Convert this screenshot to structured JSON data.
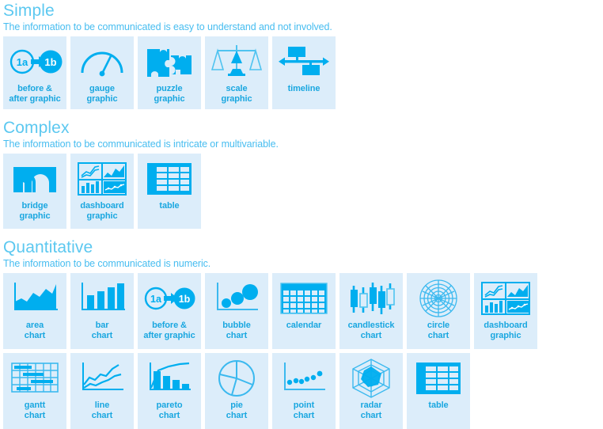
{
  "colors": {
    "tile_bg": "#dcedfa",
    "icon_blue": "#00aeef",
    "caption_blue": "#1aa7e0",
    "heading_blue": "#5cc8f0",
    "subtitle_blue": "#47bdf0",
    "page_bg": "#ffffff"
  },
  "sections": [
    {
      "id": "simple",
      "title": "Simple",
      "subtitle": "The information to be communicated is easy to understand and not involved.",
      "tiles": [
        {
          "icon": "before-after-graphic-icon",
          "label": "before &\nafter graphic",
          "line1": "before &",
          "line2": "after graphic"
        },
        {
          "icon": "gauge-graphic-icon",
          "label": "gauge graphic",
          "line1": "gauge",
          "line2": "graphic"
        },
        {
          "icon": "puzzle-graphic-icon",
          "label": "puzzle graphic",
          "line1": "puzzle",
          "line2": "graphic"
        },
        {
          "icon": "scale-graphic-icon",
          "label": "scale graphic",
          "line1": "scale",
          "line2": "graphic"
        },
        {
          "icon": "timeline-icon",
          "label": "timeline",
          "line1": "timeline",
          "line2": ""
        }
      ]
    },
    {
      "id": "complex",
      "title": "Complex",
      "subtitle": "The information to be communicated is intricate or multivariable.",
      "tiles": [
        {
          "icon": "bridge-graphic-icon",
          "label": "bridge graphic",
          "line1": "bridge",
          "line2": "graphic"
        },
        {
          "icon": "dashboard-graphic-icon",
          "label": "dashboard graphic",
          "line1": "dashboard",
          "line2": "graphic"
        },
        {
          "icon": "table-icon",
          "label": "table",
          "line1": "table",
          "line2": ""
        }
      ]
    },
    {
      "id": "quantitative",
      "title": "Quantitative",
      "subtitle": "The information to be communicated is numeric.",
      "tiles": [
        {
          "icon": "area-chart-icon",
          "label": "area chart",
          "line1": "area",
          "line2": "chart"
        },
        {
          "icon": "bar-chart-icon",
          "label": "bar chart",
          "line1": "bar",
          "line2": "chart"
        },
        {
          "icon": "before-after-graphic-icon",
          "label": "before & after graphic",
          "line1": "before &",
          "line2": "after graphic"
        },
        {
          "icon": "bubble-chart-icon",
          "label": "bubble chart",
          "line1": "bubble",
          "line2": "chart"
        },
        {
          "icon": "calendar-icon",
          "label": "calendar",
          "line1": "calendar",
          "line2": ""
        },
        {
          "icon": "candlestick-chart-icon",
          "label": "candlestick chart",
          "line1": "candlestick",
          "line2": "chart"
        },
        {
          "icon": "circle-chart-icon",
          "label": "circle chart",
          "line1": "circle",
          "line2": "chart"
        },
        {
          "icon": "dashboard-graphic-icon",
          "label": "dashboard graphic",
          "line1": "dashboard",
          "line2": "graphic"
        },
        {
          "icon": "gantt-chart-icon",
          "label": "gantt chart",
          "line1": "gantt",
          "line2": "chart"
        },
        {
          "icon": "line-chart-icon",
          "label": "line chart",
          "line1": "line",
          "line2": "chart"
        },
        {
          "icon": "pareto-chart-icon",
          "label": "pareto chart",
          "line1": "pareto",
          "line2": "chart"
        },
        {
          "icon": "pie-chart-icon",
          "label": "pie chart",
          "line1": "pie",
          "line2": "chart"
        },
        {
          "icon": "point-chart-icon",
          "label": "point chart",
          "line1": "point",
          "line2": "chart"
        },
        {
          "icon": "radar-chart-icon",
          "label": "radar chart",
          "line1": "radar",
          "line2": "chart"
        },
        {
          "icon": "table-icon",
          "label": "table",
          "line1": "table",
          "line2": ""
        }
      ]
    }
  ],
  "badge_labels": {
    "before": "1a",
    "after": "1b"
  }
}
